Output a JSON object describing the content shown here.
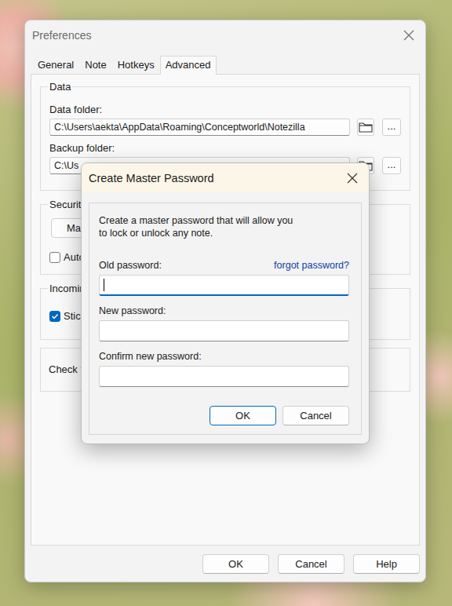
{
  "window": {
    "title": "Preferences"
  },
  "tabs": [
    {
      "label": "General",
      "selected": false
    },
    {
      "label": "Note",
      "selected": false
    },
    {
      "label": "Hotkeys",
      "selected": false
    },
    {
      "label": "Advanced",
      "selected": true
    }
  ],
  "data_group": {
    "title": "Data",
    "fields": [
      {
        "label": "Data folder:",
        "value": "C:\\Users\\aekta\\AppData\\Roaming\\Conceptworld\\Notezilla",
        "browse": "..."
      },
      {
        "label": "Backup folder:",
        "value": "C:\\Us",
        "browse": "..."
      }
    ]
  },
  "security_group": {
    "title": "Security",
    "button": "Mas",
    "checkbox": {
      "label": "Auto",
      "checked": false
    }
  },
  "incoming_group": {
    "title": "Incomin",
    "checkbox": {
      "label": "Stic",
      "checked": true
    }
  },
  "check_group": {
    "label": "Check f"
  },
  "buttons": [
    "OK",
    "Cancel",
    "Help"
  ],
  "dialog": {
    "title": "Create Master Password",
    "message": "Create a master password that will allow you to lock or unlock any note.",
    "forgot": "forgot password?",
    "fields": [
      {
        "label": "Old password:",
        "value": "",
        "focused": true
      },
      {
        "label": "New password:",
        "value": "",
        "focused": false
      },
      {
        "label": "Confirm new password:",
        "value": "",
        "focused": false
      }
    ],
    "buttons": [
      {
        "label": "OK",
        "default": true
      },
      {
        "label": "Cancel",
        "default": false
      }
    ]
  }
}
